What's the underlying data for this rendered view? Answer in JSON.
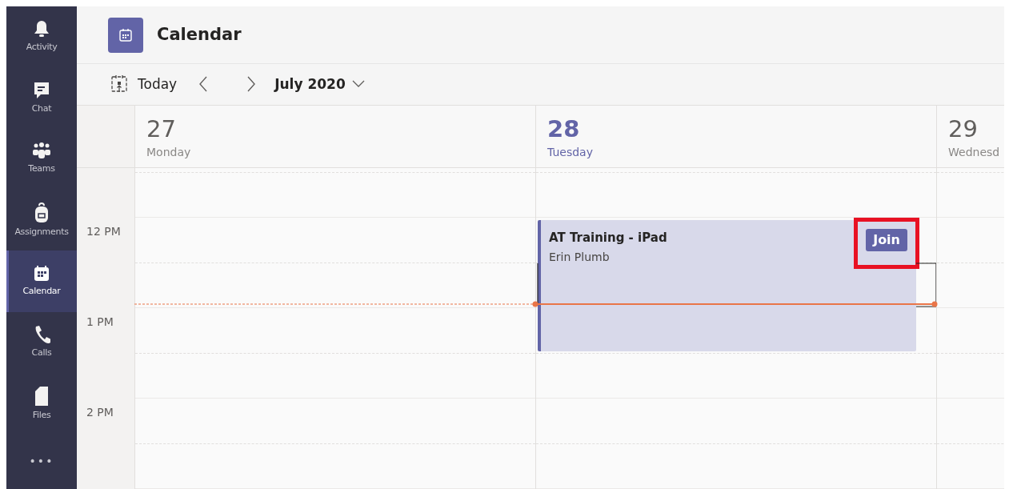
{
  "sidebar": {
    "items": [
      {
        "label": "Activity",
        "kind": "bell",
        "selected": false
      },
      {
        "label": "Chat",
        "kind": "chat",
        "selected": false
      },
      {
        "label": "Teams",
        "kind": "teams",
        "selected": false
      },
      {
        "label": "Assignments",
        "kind": "backpack",
        "selected": false
      },
      {
        "label": "Calendar",
        "kind": "calendar",
        "selected": true
      },
      {
        "label": "Calls",
        "kind": "phone",
        "selected": false
      },
      {
        "label": "Files",
        "kind": "file",
        "selected": false
      },
      {
        "label": "•••",
        "kind": "more",
        "selected": false
      }
    ]
  },
  "header": {
    "title": "Calendar"
  },
  "toolbar": {
    "today": "Today",
    "month": "July 2020"
  },
  "days": [
    {
      "number": "27",
      "name": "Monday",
      "selected": false
    },
    {
      "number": "28",
      "name": "Tuesday",
      "selected": true
    },
    {
      "number": "29",
      "name": "Wednesd",
      "selected": false
    }
  ],
  "times": [
    "12 PM",
    "1 PM",
    "2 PM"
  ],
  "event": {
    "title": "AT Training - iPad",
    "organizer": "Erin Plumb",
    "button": "Join",
    "highlighted": true
  }
}
